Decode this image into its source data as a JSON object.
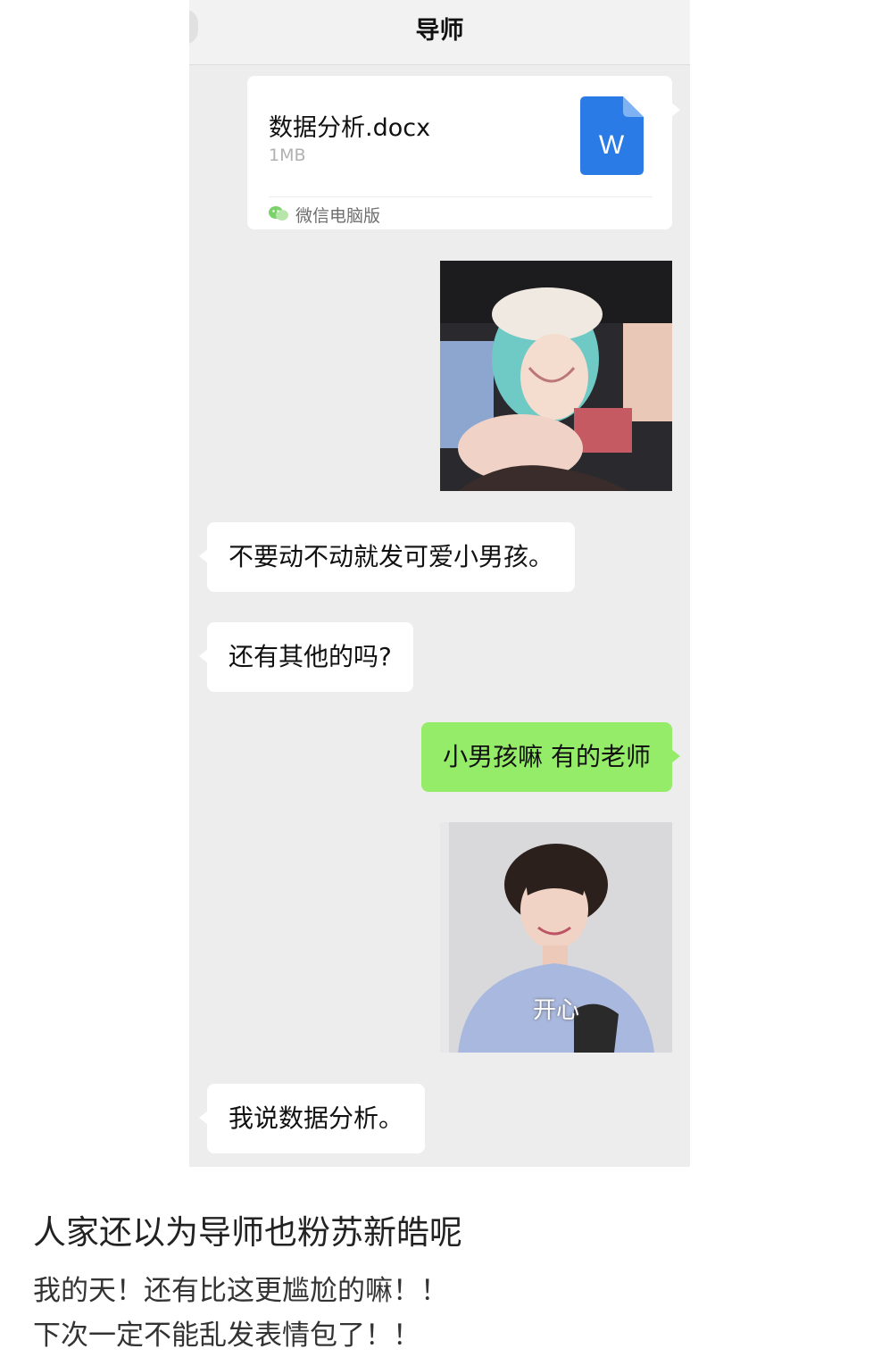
{
  "chat": {
    "title": "导师",
    "file": {
      "name": "数据分析.docx",
      "size": "1MB",
      "icon_letter": "W",
      "source": "微信电脑版"
    },
    "image_sticker_1": {
      "description_icon": "photo-sticker"
    },
    "messages": [
      {
        "side": "left",
        "text": "不要动不动就发可爱小男孩。"
      },
      {
        "side": "left",
        "text": "还有其他的吗?"
      },
      {
        "side": "right",
        "text": "小男孩嘛  有的老师"
      },
      {
        "side": "left",
        "text": "我说数据分析。"
      }
    ],
    "image_sticker_2": {
      "label": "开心"
    }
  },
  "post": {
    "title": "人家还以为导师也粉苏新皓呢",
    "lines": [
      "我的天！还有比这更尴尬的嘛！！",
      "下次一定不能乱发表情包了！！"
    ]
  },
  "colors": {
    "chat_background": "#ededed",
    "right_bubble": "#95ec69",
    "left_bubble": "#ffffff",
    "word_icon": "#2a7be6"
  }
}
